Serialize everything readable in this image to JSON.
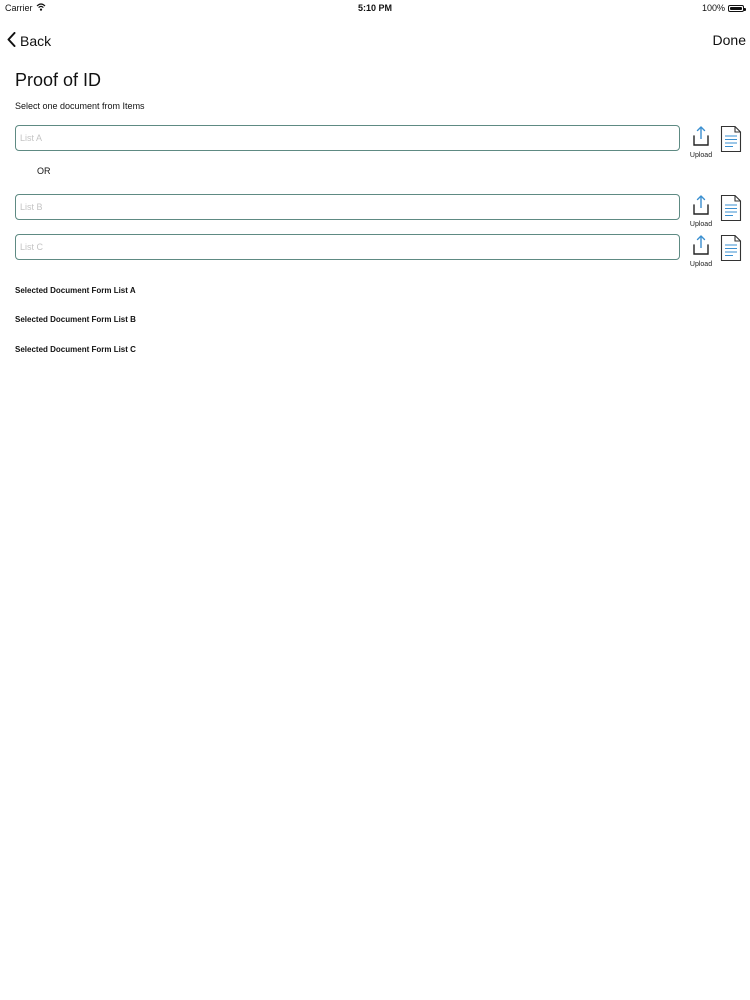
{
  "status_bar": {
    "carrier": "Carrier",
    "time": "5:10 PM",
    "battery": "100%"
  },
  "nav": {
    "back_label": "Back",
    "done_label": "Done"
  },
  "page": {
    "title": "Proof of ID",
    "subtitle": "Select one document from Items"
  },
  "fields": [
    {
      "placeholder": "List A",
      "value": "",
      "upload_label": "Upload"
    },
    {
      "placeholder": "List B",
      "value": "",
      "upload_label": "Upload"
    },
    {
      "placeholder": "List C",
      "value": "",
      "upload_label": "Upload"
    }
  ],
  "or_label": "OR",
  "selected": [
    "Selected Document Form List A",
    "Selected Document Form List B",
    "Selected Document Form List C"
  ],
  "colors": {
    "input_border": "#5e8a83",
    "icon_blue": "#3a8fd0",
    "text": "#111111"
  }
}
